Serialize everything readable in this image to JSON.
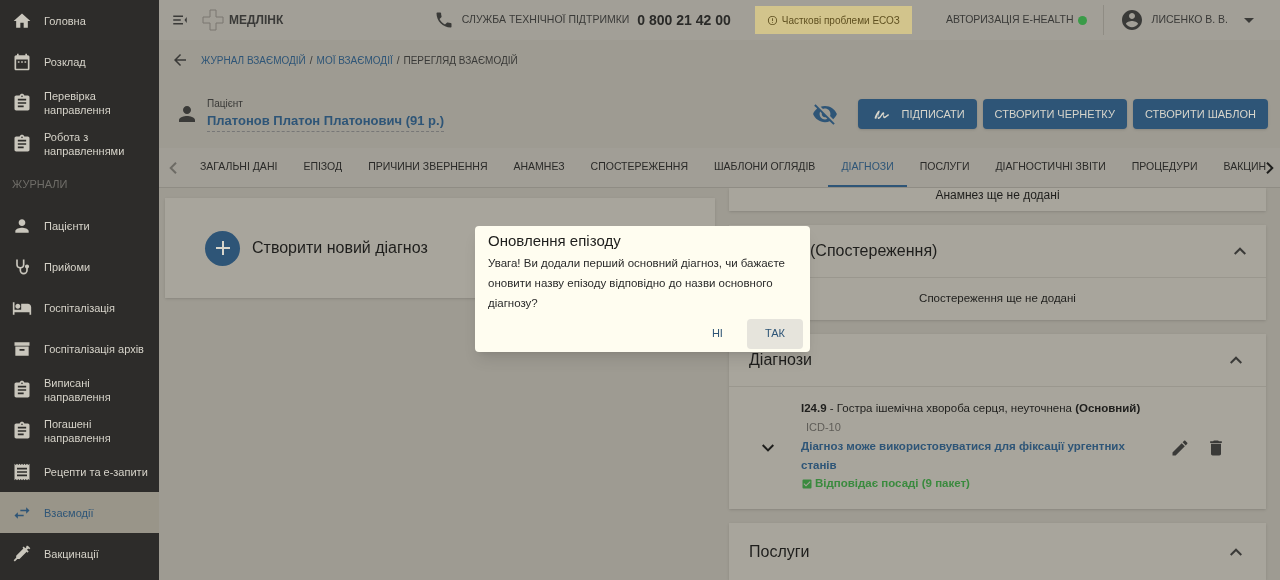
{
  "sidebar": {
    "items": [
      {
        "kind": "item",
        "label": "Головна",
        "selected": false
      },
      {
        "kind": "item",
        "label": "Розклад",
        "selected": false
      },
      {
        "kind": "item",
        "label": "Перевірка направлення",
        "selected": false
      },
      {
        "kind": "item",
        "label": "Робота з направленнями",
        "selected": false
      },
      {
        "kind": "section",
        "label": "ЖУРНАЛИ"
      },
      {
        "kind": "item",
        "label": "Пацієнти",
        "selected": false
      },
      {
        "kind": "item",
        "label": "Прийоми",
        "selected": false
      },
      {
        "kind": "item",
        "label": "Госпіталізація",
        "selected": false
      },
      {
        "kind": "item",
        "label": "Госпіталізація архів",
        "selected": false
      },
      {
        "kind": "item",
        "label": "Виписані направлення",
        "selected": false
      },
      {
        "kind": "item",
        "label": "Погашені направлення",
        "selected": false
      },
      {
        "kind": "item",
        "label": "Рецепти та е-запити",
        "selected": false
      },
      {
        "kind": "item",
        "label": "Взаємодії",
        "selected": true
      },
      {
        "kind": "item",
        "label": "Вакцинації",
        "selected": false
      }
    ]
  },
  "header": {
    "logo": "МЕДЛІНК",
    "support_label": "СЛУЖБА ТЕХНІЧНОЇ ПІДТРИМКИ",
    "support_phone": "0 800 21 42 00",
    "warning": "Часткові проблеми ЕСОЗ",
    "auth_label": "АВТОРИЗАЦІЯ E-HEALTH",
    "auth_online": true,
    "user": "ЛИСЕНКО В. В."
  },
  "breadcrumb_separator": "/",
  "breadcrumbs": [
    {
      "label": "ЖУРНАЛ ВЗАЄМОДІЙ",
      "link": true
    },
    {
      "label": "МОЇ ВЗАЄМОДІЇ",
      "link": true
    },
    {
      "label": "ПЕРЕГЛЯД ВЗАЄМОДІЙ",
      "link": false
    }
  ],
  "patient": {
    "label": "Пацієнт",
    "name": "Платонов Платон Платонович (91 р.)"
  },
  "actions": [
    "ПІДПИСАТИ",
    "СТВОРИТИ ЧЕРНЕТКУ",
    "СТВОРИТИ ШАБЛОН"
  ],
  "tabs": [
    {
      "label": "ЗАГАЛЬНІ ДАНІ",
      "selected": false
    },
    {
      "label": "ЕПІЗОД",
      "selected": false
    },
    {
      "label": "ПРИЧИНИ ЗВЕРНЕННЯ",
      "selected": false
    },
    {
      "label": "АНАМНЕЗ",
      "selected": false
    },
    {
      "label": "СПОСТЕРЕЖЕННЯ",
      "selected": false
    },
    {
      "label": "ШАБЛОНИ ОГЛЯДІВ",
      "selected": false
    },
    {
      "label": "ДІАГНОЗИ",
      "selected": true
    },
    {
      "label": "ПОСЛУГИ",
      "selected": false
    },
    {
      "label": "ДІАГНОСТИЧНІ ЗВІТИ",
      "selected": false
    },
    {
      "label": "ПРОЦЕДУРИ",
      "selected": false
    },
    {
      "label": "ВАКЦИН",
      "selected": false
    }
  ],
  "create_diagnosis": "Створити новий діагноз",
  "anamnesis_empty": "Анамнез ще не додані",
  "observations": {
    "title": "(Спостереження)",
    "empty": "Спостереження ще не додані"
  },
  "diagnoses": {
    "title": "Діагнози",
    "items": [
      {
        "code": "I24.9",
        "name": " - Гостра ішемічна хвороба серця, неуточнена ",
        "role": "(Основний)",
        "system": "ICD-10",
        "note": "Діагноз може використовуватися для фіксації ургентних станів",
        "check": "Відповідає посаді (9 пакет)"
      }
    ]
  },
  "services": {
    "title": "Послуги"
  },
  "dialog": {
    "title": "Оновлення епізоду",
    "text": "Увага! Ви додали перший основний діагноз, чи бажаєте оновити назву епізоду відповідно до назви основного діагнозу?",
    "buttons": [
      {
        "label": "НІ",
        "selected": false
      },
      {
        "label": "ТАК",
        "selected": true
      }
    ]
  }
}
